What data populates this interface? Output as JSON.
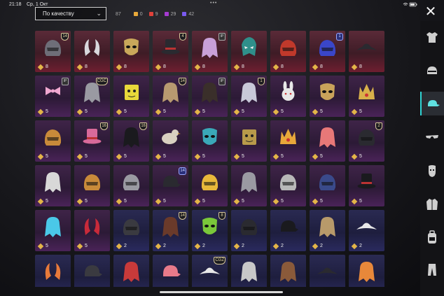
{
  "status_bar": {
    "time": "21:18",
    "date": "Ср, 1 Окт",
    "dots": "•••"
  },
  "sort_dropdown": {
    "label": "По качеству"
  },
  "counts": {
    "total": "87",
    "tiers": [
      {
        "value": "0",
        "color": "#e8a93a"
      },
      {
        "value": "9",
        "color": "#e0413a"
      },
      {
        "value": "29",
        "color": "#a53ad1"
      },
      {
        "value": "42",
        "color": "#7a5af0"
      }
    ]
  },
  "close_button": {
    "icon": "close-icon"
  },
  "sidebar": {
    "tabs": [
      {
        "name": "tab-outfit",
        "icon": "shirt-icon",
        "active": false
      },
      {
        "name": "tab-helmet",
        "icon": "helmet-icon",
        "active": false
      },
      {
        "name": "tab-headwear",
        "icon": "cap-icon",
        "active": true
      },
      {
        "name": "tab-eyewear",
        "icon": "glasses-icon",
        "active": false
      },
      {
        "name": "tab-mask",
        "icon": "mask-icon",
        "active": false
      },
      {
        "name": "tab-top",
        "icon": "jacket-icon",
        "active": false
      },
      {
        "name": "tab-backpack",
        "icon": "backpack-icon",
        "active": false
      },
      {
        "name": "tab-pants",
        "icon": "pants-icon",
        "active": false
      }
    ]
  },
  "grid": {
    "columns": 9,
    "rows": [
      {
        "tier": "red",
        "items": [
          {
            "count": "8",
            "badge": "14",
            "badge_type": "shield",
            "color": "#6e6e78",
            "shape": "helmet"
          },
          {
            "count": "8",
            "badge": "",
            "color": "#d8d8dc",
            "shape": "horns"
          },
          {
            "count": "8",
            "badge": "",
            "color": "#c9a75a",
            "shape": "mask"
          },
          {
            "count": "8",
            "badge": "4",
            "badge_type": "shield",
            "color": "#2a2a30",
            "shape": "tophat"
          },
          {
            "count": "8",
            "badge": "IP",
            "badge_type": "tagp",
            "color": "#c8a0d8",
            "shape": "hair"
          },
          {
            "count": "8",
            "badge": "",
            "color": "#2f8f8a",
            "shape": "dragon"
          },
          {
            "count": "8",
            "badge": "",
            "color": "#c0392b",
            "shape": "helmet"
          },
          {
            "count": "8",
            "badge": "1",
            "badge_type": "blue",
            "color": "#3a46c8",
            "shape": "helmet"
          },
          {
            "count": "8",
            "badge": "",
            "color": "#2a2a30",
            "shape": "pirate"
          }
        ]
      },
      {
        "tier": "purple",
        "items": [
          {
            "count": "5",
            "badge": "IP",
            "badge_type": "tagp",
            "color": "#f0a8d0",
            "shape": "bow"
          },
          {
            "count": "5",
            "badge": "CGC",
            "badge_type": "shield",
            "color": "#9a9aa2",
            "shape": "hair"
          },
          {
            "count": "5",
            "badge": "",
            "color": "#e8d83a",
            "shape": "box"
          },
          {
            "count": "5",
            "badge": "14",
            "badge_type": "shield",
            "color": "#b89a70",
            "shape": "hair"
          },
          {
            "count": "5",
            "badge": "IP",
            "badge_type": "tagp",
            "color": "#3a2f2a",
            "shape": "hair"
          },
          {
            "count": "5",
            "badge": "1",
            "badge_type": "shield",
            "color": "#c8c8d8",
            "shape": "hair"
          },
          {
            "count": "5",
            "badge": "",
            "color": "#e8e8e8",
            "shape": "bunny"
          },
          {
            "count": "5",
            "badge": "",
            "color": "#c9a35a",
            "shape": "mask"
          },
          {
            "count": "5",
            "badge": "",
            "color": "#d8b04a",
            "shape": "crown"
          }
        ]
      },
      {
        "tier": "purple",
        "items": [
          {
            "count": "5",
            "badge": "",
            "color": "#c88a3a",
            "shape": "helmet"
          },
          {
            "count": "5",
            "badge": "16",
            "badge_type": "shield",
            "color": "#d86a9a",
            "shape": "tophat"
          },
          {
            "count": "5",
            "badge": "16",
            "badge_type": "shield",
            "color": "#1a1a1e",
            "shape": "hair"
          },
          {
            "count": "5",
            "badge": "",
            "color": "#d8d0c0",
            "shape": "bird"
          },
          {
            "count": "5",
            "badge": "",
            "color": "#3aa8b8",
            "shape": "mask"
          },
          {
            "count": "5",
            "badge": "",
            "color": "#b89a4a",
            "shape": "box"
          },
          {
            "count": "5",
            "badge": "",
            "color": "#e8a83a",
            "shape": "crown"
          },
          {
            "count": "5",
            "badge": "",
            "color": "#e87878",
            "shape": "hair"
          },
          {
            "count": "5",
            "badge": "2",
            "badge_type": "shield",
            "color": "#2a2a30",
            "shape": "helmet"
          }
        ]
      },
      {
        "tier": "purple",
        "items": [
          {
            "count": "5",
            "badge": "",
            "color": "#d8d8d8",
            "shape": "hair"
          },
          {
            "count": "5",
            "badge": "",
            "color": "#c88a3a",
            "shape": "helmet"
          },
          {
            "count": "5",
            "badge": "",
            "color": "#9a9aa2",
            "shape": "helmet"
          },
          {
            "count": "5",
            "badge": "14",
            "badge_type": "blue",
            "color": "#2a2a30",
            "shape": "cap"
          },
          {
            "count": "5",
            "badge": "",
            "color": "#e8b83a",
            "shape": "helmet"
          },
          {
            "count": "5",
            "badge": "",
            "color": "#9a9aa2",
            "shape": "hair"
          },
          {
            "count": "5",
            "badge": "",
            "color": "#b8b8b8",
            "shape": "helmet"
          },
          {
            "count": "5",
            "badge": "",
            "color": "#3a4a8a",
            "shape": "helmet"
          },
          {
            "count": "5",
            "badge": "",
            "color": "#1a1a1e",
            "shape": "tophat"
          }
        ]
      },
      {
        "tier": "purple_to_blue",
        "items": [
          {
            "count": "5",
            "badge": "",
            "color": "#4ac8e8",
            "shape": "hair"
          },
          {
            "count": "5",
            "badge": "",
            "color": "#c82a3a",
            "shape": "horns"
          },
          {
            "count": "2",
            "badge": "",
            "color": "#3a3a40",
            "shape": "helmet"
          },
          {
            "count": "2",
            "badge": "14",
            "badge_type": "shield",
            "color": "#6a3a2a",
            "shape": "hair"
          },
          {
            "count": "2",
            "badge": "8",
            "badge_type": "shield",
            "color": "#7ac83a",
            "shape": "mask"
          },
          {
            "count": "2",
            "badge": "",
            "color": "#2a2a30",
            "shape": "helmet"
          },
          {
            "count": "2",
            "badge": "",
            "color": "#1a1a1e",
            "shape": "cap"
          },
          {
            "count": "2",
            "badge": "",
            "color": "#b89a6a",
            "shape": "hair"
          },
          {
            "count": "2",
            "badge": "",
            "color": "#e8e8e8",
            "shape": "pirate"
          }
        ]
      },
      {
        "tier": "blue",
        "items": [
          {
            "count": "",
            "badge": "",
            "color": "#e87a3a",
            "shape": "horns"
          },
          {
            "count": "",
            "badge": "",
            "color": "#3a3a40",
            "shape": "cap"
          },
          {
            "count": "",
            "badge": "",
            "color": "#c83a3a",
            "shape": "hair"
          },
          {
            "count": "",
            "badge": "",
            "color": "#e87a8a",
            "shape": "cap"
          },
          {
            "count": "",
            "badge": "CGZ",
            "badge_type": "shield",
            "color": "#e8e8e8",
            "shape": "pirate"
          },
          {
            "count": "",
            "badge": "",
            "color": "#c8c8c8",
            "shape": "hair"
          },
          {
            "count": "",
            "badge": "",
            "color": "#8a5a3a",
            "shape": "hair"
          },
          {
            "count": "",
            "badge": "",
            "color": "#2a2a30",
            "shape": "pirate"
          },
          {
            "count": "",
            "badge": "",
            "color": "#e8883a",
            "shape": "hair"
          }
        ]
      }
    ]
  }
}
